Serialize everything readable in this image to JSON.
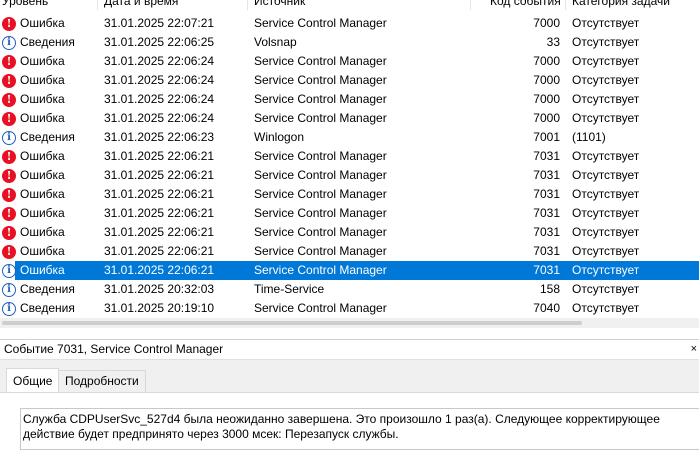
{
  "columns": {
    "level": "Уровень",
    "date": "Дата и время",
    "source": "Источник",
    "event_id": "Код события",
    "category": "Категория задачи"
  },
  "rows": [
    {
      "type": "error",
      "level": "Ошибка",
      "date": "31.01.2025 22:07:21",
      "source": "Service Control Manager",
      "event_id": "7000",
      "category": "Отсутствует"
    },
    {
      "type": "info",
      "level": "Сведения",
      "date": "31.01.2025 22:06:25",
      "source": "Volsnap",
      "event_id": "33",
      "category": "Отсутствует"
    },
    {
      "type": "error",
      "level": "Ошибка",
      "date": "31.01.2025 22:06:24",
      "source": "Service Control Manager",
      "event_id": "7000",
      "category": "Отсутствует"
    },
    {
      "type": "error",
      "level": "Ошибка",
      "date": "31.01.2025 22:06:24",
      "source": "Service Control Manager",
      "event_id": "7000",
      "category": "Отсутствует"
    },
    {
      "type": "error",
      "level": "Ошибка",
      "date": "31.01.2025 22:06:24",
      "source": "Service Control Manager",
      "event_id": "7000",
      "category": "Отсутствует"
    },
    {
      "type": "error",
      "level": "Ошибка",
      "date": "31.01.2025 22:06:24",
      "source": "Service Control Manager",
      "event_id": "7000",
      "category": "Отсутствует"
    },
    {
      "type": "info",
      "level": "Сведения",
      "date": "31.01.2025 22:06:23",
      "source": "Winlogon",
      "event_id": "7001",
      "category": "(1101)"
    },
    {
      "type": "error",
      "level": "Ошибка",
      "date": "31.01.2025 22:06:21",
      "source": "Service Control Manager",
      "event_id": "7031",
      "category": "Отсутствует"
    },
    {
      "type": "error",
      "level": "Ошибка",
      "date": "31.01.2025 22:06:21",
      "source": "Service Control Manager",
      "event_id": "7031",
      "category": "Отсутствует"
    },
    {
      "type": "error",
      "level": "Ошибка",
      "date": "31.01.2025 22:06:21",
      "source": "Service Control Manager",
      "event_id": "7031",
      "category": "Отсутствует"
    },
    {
      "type": "error",
      "level": "Ошибка",
      "date": "31.01.2025 22:06:21",
      "source": "Service Control Manager",
      "event_id": "7031",
      "category": "Отсутствует"
    },
    {
      "type": "error",
      "level": "Ошибка",
      "date": "31.01.2025 22:06:21",
      "source": "Service Control Manager",
      "event_id": "7031",
      "category": "Отсутствует"
    },
    {
      "type": "error",
      "level": "Ошибка",
      "date": "31.01.2025 22:06:21",
      "source": "Service Control Manager",
      "event_id": "7031",
      "category": "Отсутствует"
    },
    {
      "type": "info",
      "level": "Ошибка",
      "date": "31.01.2025 22:06:21",
      "source": "Service Control Manager",
      "event_id": "7031",
      "category": "Отсутствует",
      "selected": true
    },
    {
      "type": "info",
      "level": "Сведения",
      "date": "31.01.2025 20:32:03",
      "source": "Time-Service",
      "event_id": "158",
      "category": "Отсутствует"
    },
    {
      "type": "info",
      "level": "Сведения",
      "date": "31.01.2025 20:19:10",
      "source": "Service Control Manager",
      "event_id": "7040",
      "category": "Отсутствует"
    }
  ],
  "icons": {
    "error": "error-icon",
    "info": "info-icon"
  },
  "colors": {
    "selection": "#0078d7",
    "error": "#e81123",
    "info": "#1f5fbf"
  },
  "event_panel": {
    "title": "Событие 7031, Service Control Manager",
    "close": "×",
    "tabs": [
      {
        "label": "Общие",
        "active": true
      },
      {
        "label": "Подробности",
        "active": false
      }
    ],
    "description": "Служба CDPUserSvc_527d4 была неожиданно завершена. Это произошло 1 раз(а). Следующее корректирующее действие будет предпринято через 3000 мсек: Перезапуск службы."
  }
}
